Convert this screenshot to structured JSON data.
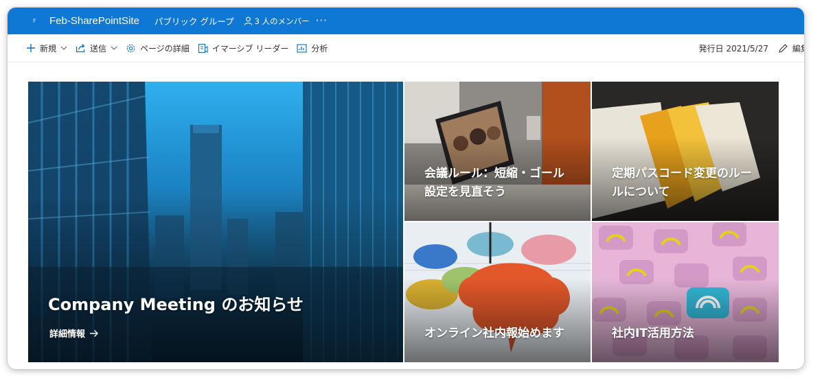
{
  "header": {
    "site_logo": "F",
    "site_name": "Feb-SharePointSite",
    "site_type": "パブリック グループ",
    "members": "3 人のメンバー",
    "more": "···"
  },
  "commands": {
    "new": "新規",
    "send": "送信",
    "page_details": "ページの詳細",
    "immersive_reader": "イマーシブ リーダー",
    "analytics": "分析",
    "published": "発行日 2021/5/27",
    "edit": "編集"
  },
  "hero": {
    "title": "Company Meeting のお知らせ",
    "link": "詳細情報"
  },
  "tiles": [
    {
      "title": "会議ルール：短縮・ゴール設定を見直そう"
    },
    {
      "title": "定期パスコード変更のルールについて"
    },
    {
      "title": "オンライン社内報始めます"
    },
    {
      "title": "社内IT活用方法"
    }
  ],
  "colors": {
    "suitebar": "#0f78d4",
    "command_icon": "#0f6cbd"
  },
  "icons": [
    "plus-icon",
    "chevron-down-icon",
    "share-icon",
    "gear-icon",
    "immersive-reader-icon",
    "analytics-icon",
    "pencil-icon",
    "person-icon",
    "arrow-right-icon"
  ]
}
